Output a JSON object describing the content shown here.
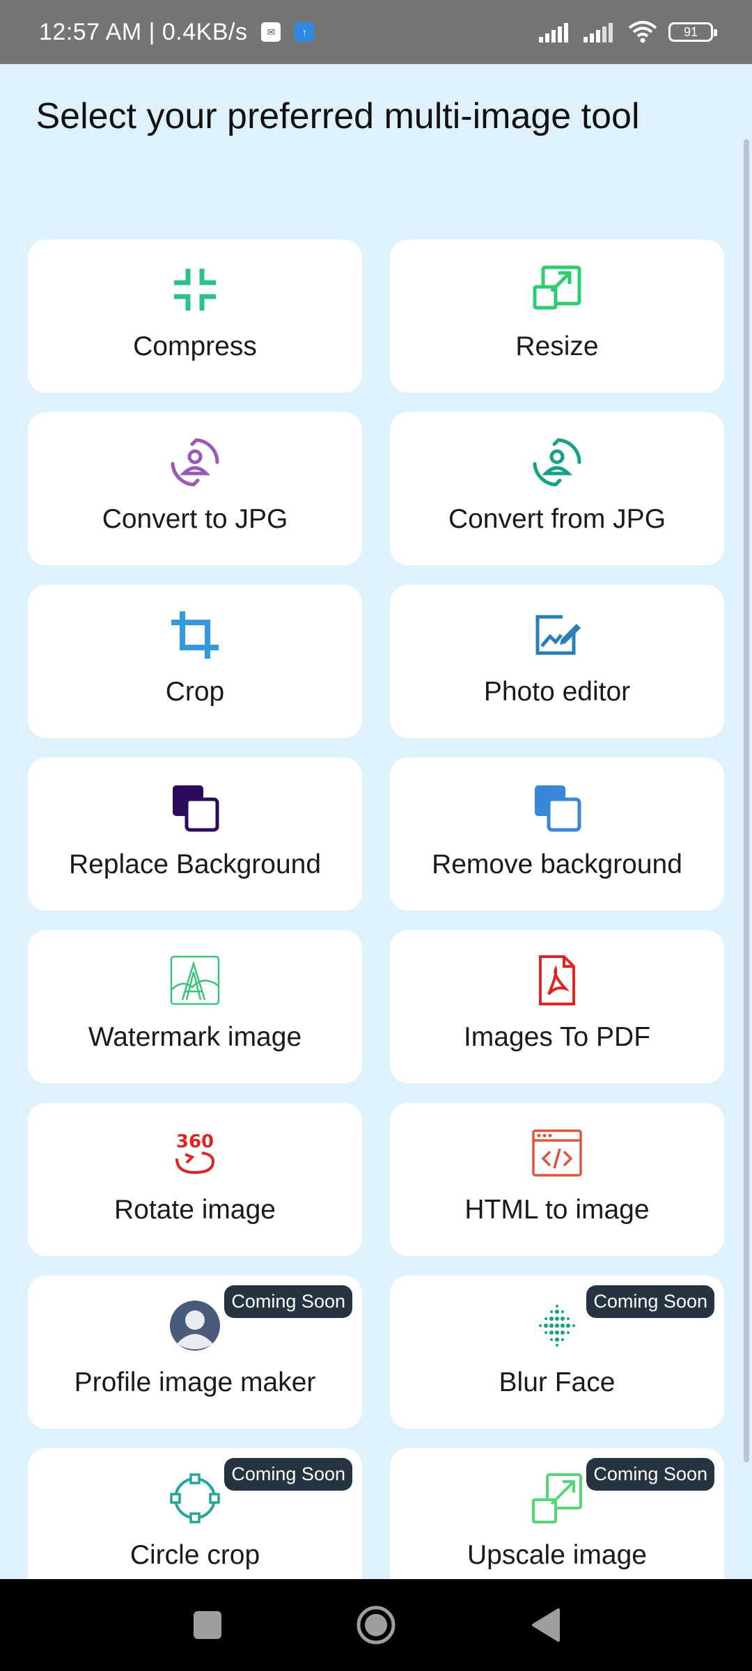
{
  "status_bar": {
    "time": "12:57 AM | 0.4KB/s",
    "battery": "91",
    "notification_icons": [
      "sms-icon",
      "upload-icon"
    ]
  },
  "page": {
    "title": "Select your preferred multi-image tool"
  },
  "tools": [
    {
      "label": "Compress",
      "icon": "compress-icon",
      "color": "#2ebf91"
    },
    {
      "label": "Resize",
      "icon": "resize-icon",
      "color": "#2ecc71"
    },
    {
      "label": "Convert to JPG",
      "icon": "convert-to-jpg-icon",
      "color": "#9b59b6"
    },
    {
      "label": "Convert from JPG",
      "icon": "convert-from-jpg-icon",
      "color": "#16a085"
    },
    {
      "label": "Crop",
      "icon": "crop-icon",
      "color": "#3498db"
    },
    {
      "label": "Photo editor",
      "icon": "photo-editor-icon",
      "color": "#2980b9"
    },
    {
      "label": "Replace Background",
      "icon": "replace-background-icon",
      "color": "#2c0b5e"
    },
    {
      "label": "Remove background",
      "icon": "remove-background-icon",
      "color": "#3a86d9"
    },
    {
      "label": "Watermark image",
      "icon": "watermark-icon",
      "color": "#3cc27a"
    },
    {
      "label": "Images To PDF",
      "icon": "pdf-icon",
      "color": "#e02424"
    },
    {
      "label": "Rotate image",
      "icon": "rotate-360-icon",
      "color": "#e02424"
    },
    {
      "label": "HTML to image",
      "icon": "html-code-icon",
      "color": "#e0533a"
    },
    {
      "label": "Profile image maker",
      "icon": "avatar-icon",
      "color": "#4a5a7a",
      "badge": "Coming Soon"
    },
    {
      "label": "Blur Face",
      "icon": "blur-dots-icon",
      "color": "#16a085",
      "badge": "Coming Soon"
    },
    {
      "label": "Circle crop",
      "icon": "circle-crop-icon",
      "color": "#26a69a",
      "badge": "Coming Soon"
    },
    {
      "label": "Upscale image",
      "icon": "upscale-icon",
      "color": "#55d67a",
      "badge": "Coming Soon"
    }
  ],
  "nav": {
    "items": [
      "recents-button",
      "home-button",
      "back-button"
    ]
  }
}
